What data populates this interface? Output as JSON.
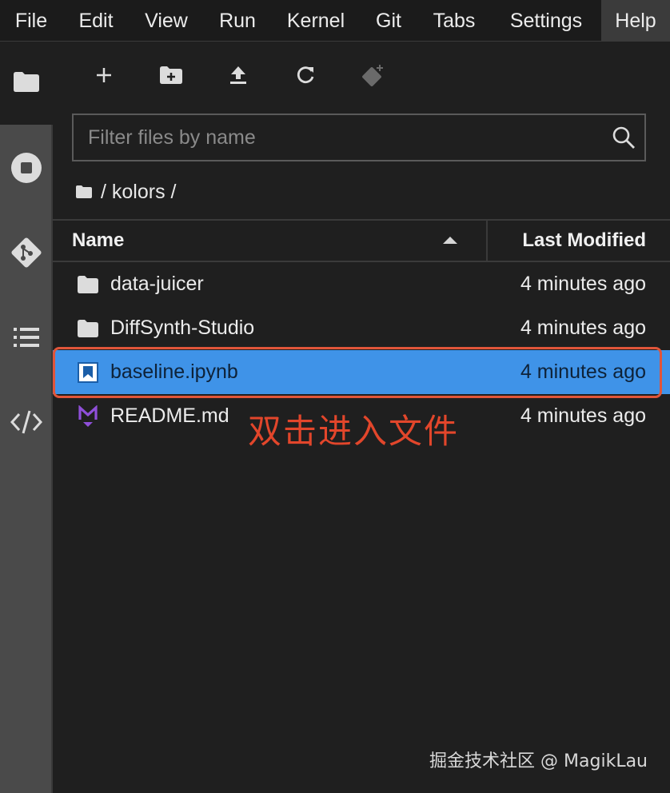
{
  "menubar": {
    "items": [
      "File",
      "Edit",
      "View",
      "Run",
      "Kernel",
      "Git",
      "Tabs",
      "Settings",
      "Help"
    ],
    "active": "Help"
  },
  "rail": {
    "icons": [
      "folder-icon",
      "stop-circle-icon",
      "git-icon",
      "list-icon",
      "code-icon"
    ]
  },
  "toolbar": {
    "buttons": [
      "plus-icon",
      "new-folder-icon",
      "upload-icon",
      "refresh-icon",
      "git-clone-icon"
    ]
  },
  "filter": {
    "placeholder": "Filter files by name",
    "value": ""
  },
  "breadcrumb": {
    "path": "/ kolors /"
  },
  "file_list": {
    "header": {
      "name": "Name",
      "modified": "Last Modified"
    },
    "rows": [
      {
        "name": "data-juicer",
        "modified": "4 minutes ago",
        "icon": "folder-icon",
        "selected": false
      },
      {
        "name": "DiffSynth-Studio",
        "modified": "4 minutes ago",
        "icon": "folder-icon",
        "selected": false
      },
      {
        "name": "baseline.ipynb",
        "modified": "4 minutes ago",
        "icon": "notebook-icon",
        "selected": true
      },
      {
        "name": "README.md",
        "modified": "4 minutes ago",
        "icon": "markdown-icon",
        "selected": false
      }
    ]
  },
  "annotation": {
    "text": "双击进入文件",
    "color": "#e2462b"
  },
  "watermark": {
    "text": "掘金技术社区 @ MagikLau"
  },
  "colors": {
    "selected_row": "#3f93e8",
    "highlight_border": "#e0553a",
    "rail": "#4a4a4a",
    "background": "#1f1f1f"
  }
}
